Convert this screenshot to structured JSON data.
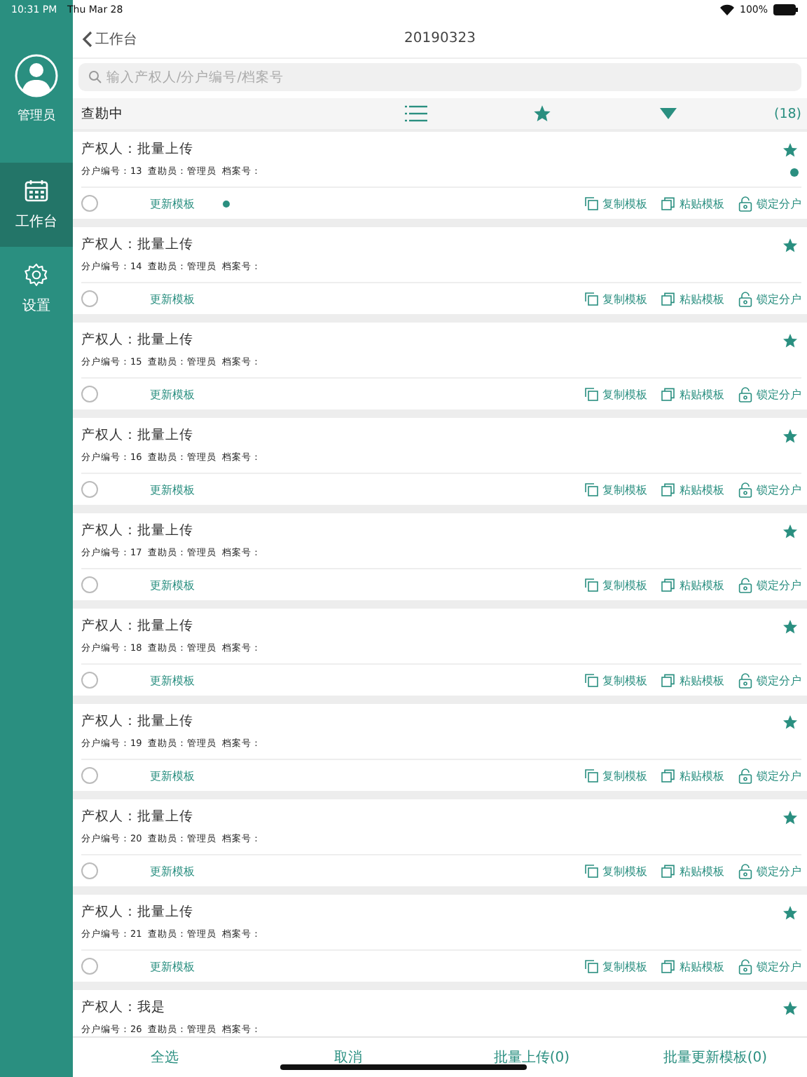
{
  "status_bar": {
    "time": "10:31 PM",
    "date": "Thu Mar 28",
    "battery": "100%"
  },
  "sidebar": {
    "user": "管理员",
    "items": [
      {
        "label": "工作台",
        "kind": "calendar",
        "selected": true
      },
      {
        "label": "设置",
        "kind": "gear",
        "selected": false
      }
    ]
  },
  "nav": {
    "back": "工作台",
    "title": "20190323"
  },
  "search": {
    "placeholder": "输入产权人/分户编号/档案号"
  },
  "filter": {
    "status": "查勘中",
    "count": "(18)"
  },
  "cards": [
    {
      "owner": "产权人：批量上传",
      "details": "分户编号：13  查勘员：管理员  档案号：",
      "starred": true,
      "updated": true,
      "checked": false,
      "actions": [
        "更新模板",
        "复制模板",
        "粘贴模板",
        "锁定分户"
      ]
    },
    {
      "owner": "产权人：批量上传",
      "details": "分户编号：14  查勘员：管理员  档案号：",
      "starred": true,
      "updated": false,
      "checked": false,
      "actions": [
        "更新模板",
        "复制模板",
        "粘贴模板",
        "锁定分户"
      ]
    },
    {
      "owner": "产权人：批量上传",
      "details": "分户编号：15  查勘员：管理员  档案号：",
      "starred": true,
      "updated": false,
      "checked": false,
      "actions": [
        "更新模板",
        "复制模板",
        "粘贴模板",
        "锁定分户"
      ]
    },
    {
      "owner": "产权人：批量上传",
      "details": "分户编号：16  查勘员：管理员  档案号：",
      "starred": true,
      "updated": false,
      "checked": false,
      "actions": [
        "更新模板",
        "复制模板",
        "粘贴模板",
        "锁定分户"
      ]
    },
    {
      "owner": "产权人：批量上传",
      "details": "分户编号：17  查勘员：管理员  档案号：",
      "starred": true,
      "updated": false,
      "checked": false,
      "actions": [
        "更新模板",
        "复制模板",
        "粘贴模板",
        "锁定分户"
      ]
    },
    {
      "owner": "产权人：批量上传",
      "details": "分户编号：18  查勘员：管理员  档案号：",
      "starred": true,
      "updated": false,
      "checked": false,
      "actions": [
        "更新模板",
        "复制模板",
        "粘贴模板",
        "锁定分户"
      ]
    },
    {
      "owner": "产权人：批量上传",
      "details": "分户编号：19  查勘员：管理员  档案号：",
      "starred": true,
      "updated": false,
      "checked": false,
      "actions": [
        "更新模板",
        "复制模板",
        "粘贴模板",
        "锁定分户"
      ]
    },
    {
      "owner": "产权人：批量上传",
      "details": "分户编号：20  查勘员：管理员  档案号：",
      "starred": true,
      "updated": false,
      "checked": false,
      "actions": [
        "更新模板",
        "复制模板",
        "粘贴模板",
        "锁定分户"
      ]
    },
    {
      "owner": "产权人：批量上传",
      "details": "分户编号：21  查勘员：管理员  档案号：",
      "starred": true,
      "updated": false,
      "checked": false,
      "actions": [
        "更新模板",
        "复制模板",
        "粘贴模板",
        "锁定分户"
      ]
    },
    {
      "owner": "产权人：我是",
      "details": "分户编号：26  查勘员：管理员  档案号：",
      "starred": true,
      "updated": false
    }
  ],
  "bottom_bar": [
    "全选",
    "取消",
    "批量上传(0)",
    "批量更新模板(0)"
  ]
}
